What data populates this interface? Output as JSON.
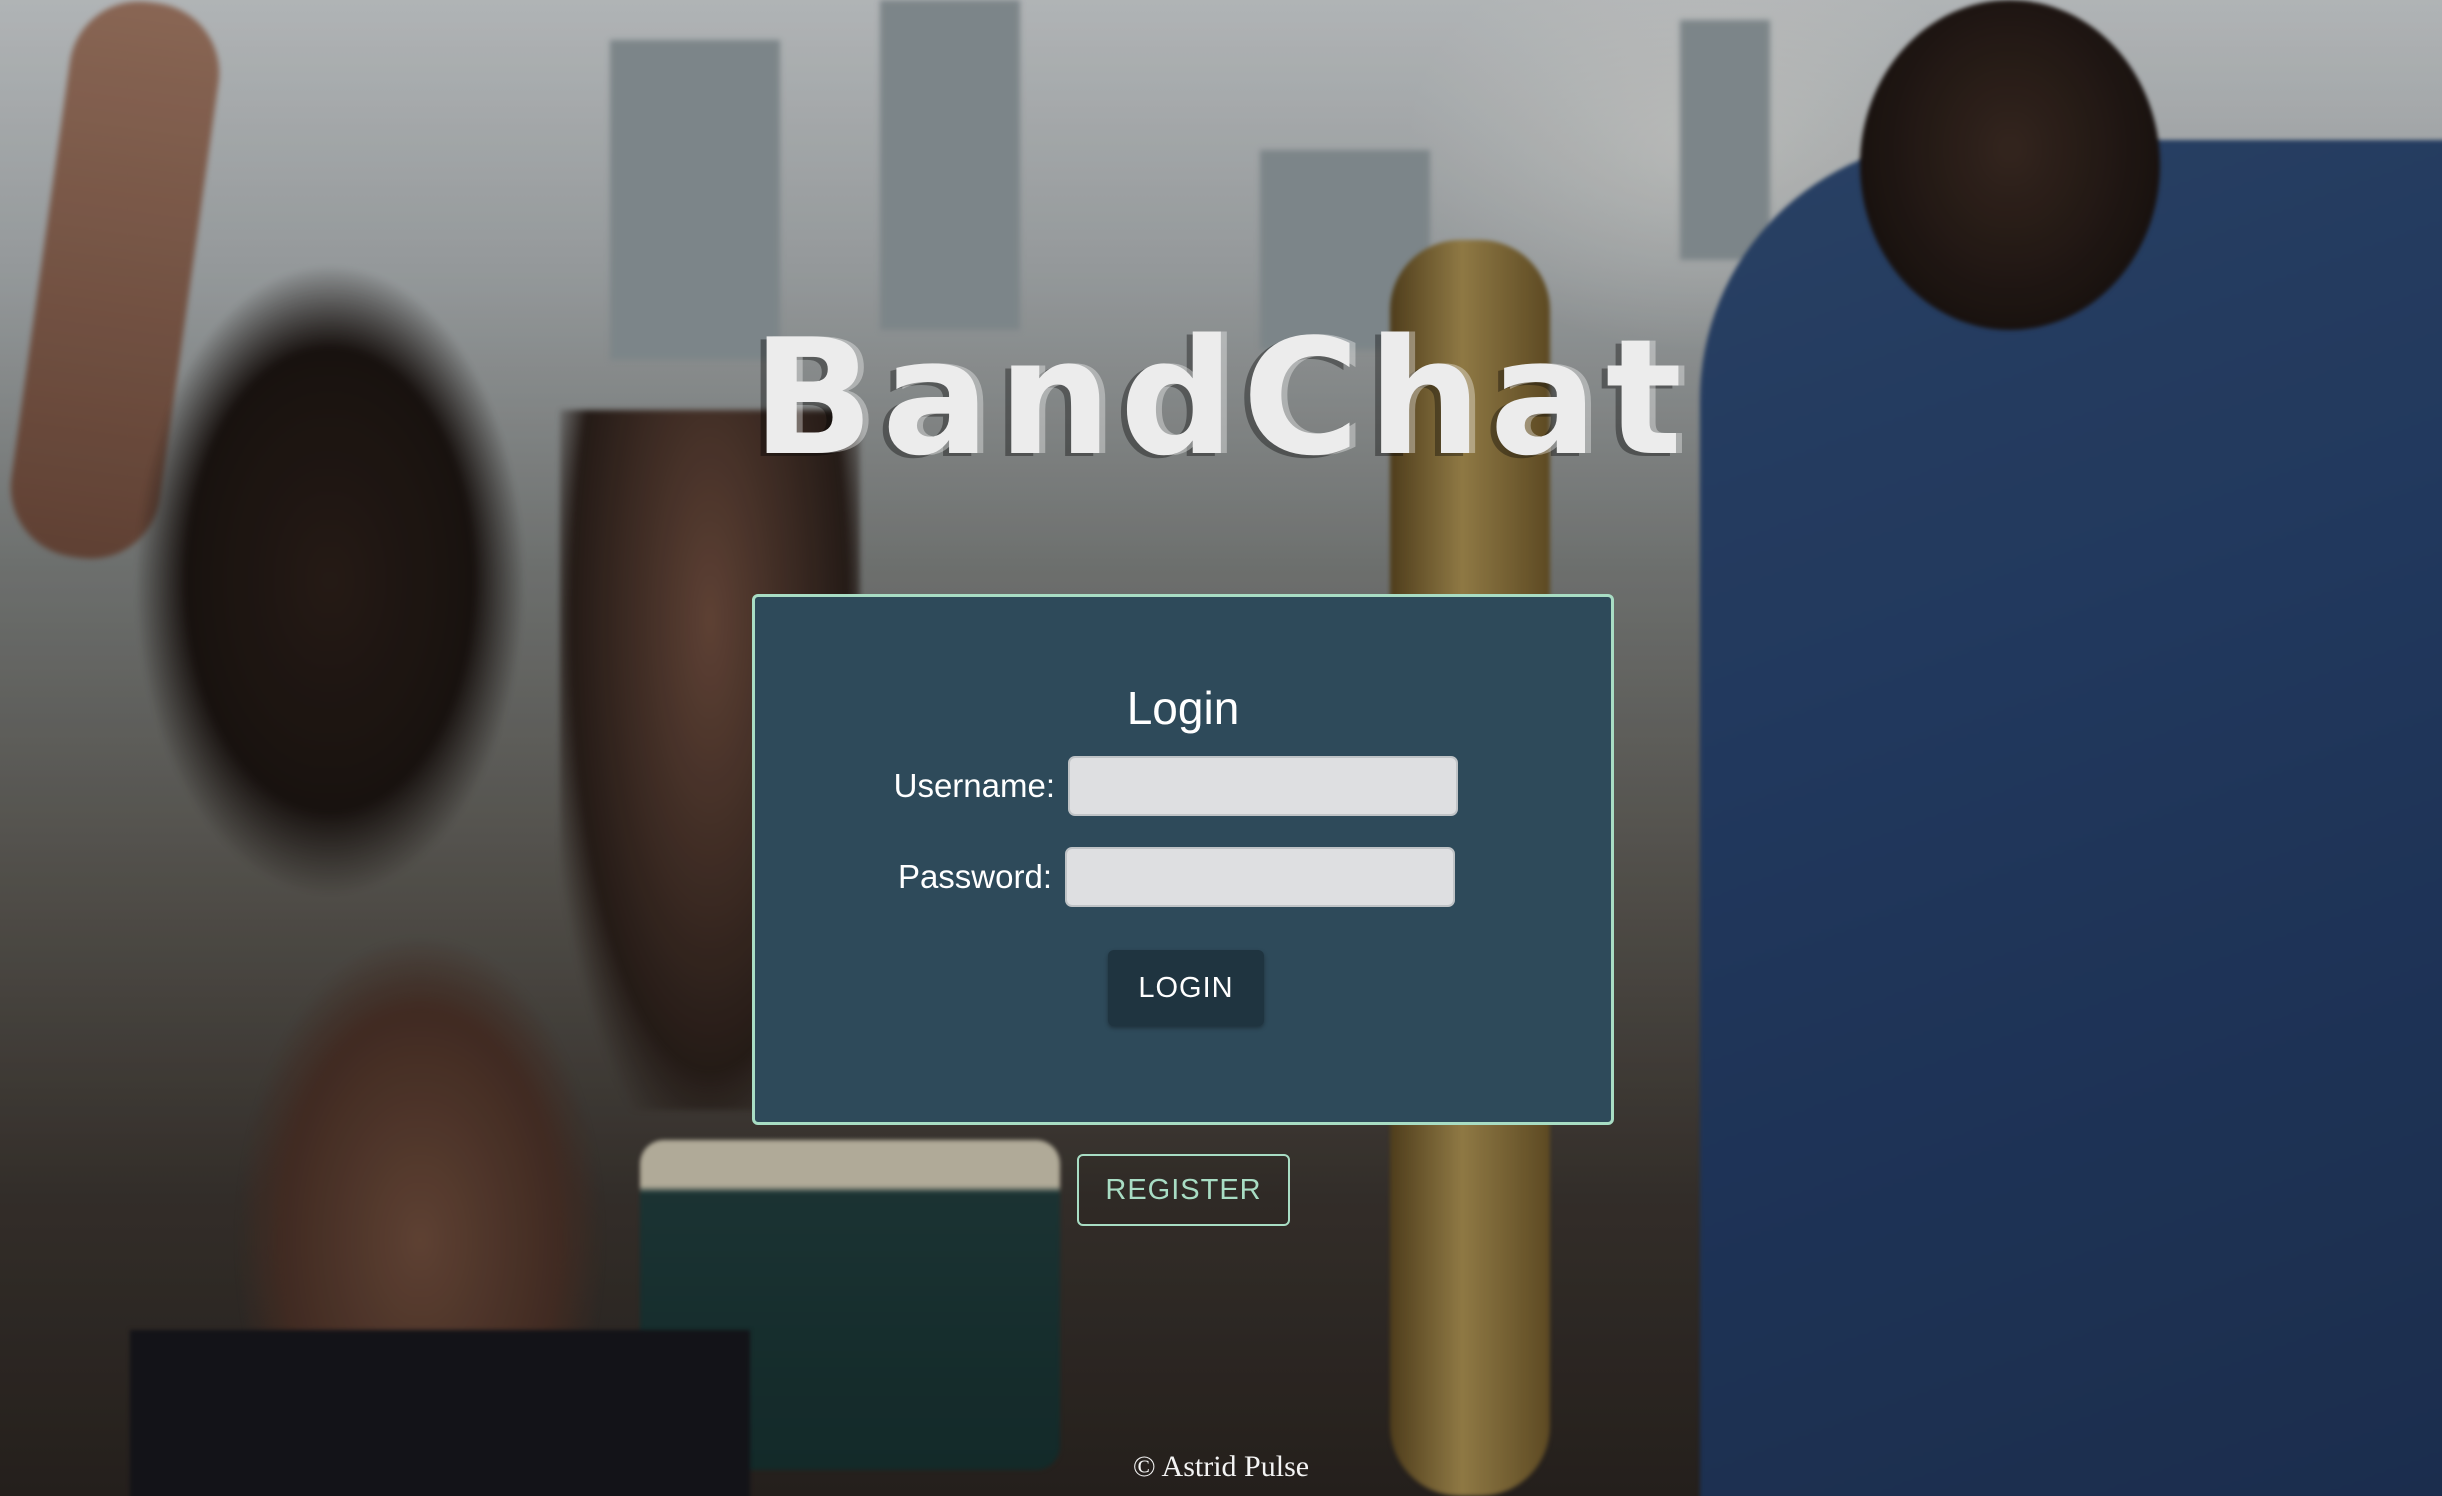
{
  "app": {
    "logo_text": "BandChat"
  },
  "login": {
    "title": "Login",
    "username_label": "Username:",
    "username_value": "",
    "password_label": "Password:",
    "password_value": "",
    "submit_label": "LOGIN"
  },
  "register": {
    "label": "REGISTER"
  },
  "footer": {
    "copyright": "© Astrid Pulse"
  },
  "colors": {
    "card_background": "#2e4a5a",
    "card_border": "#a8ddc4",
    "login_button": "#1f3440",
    "register_accent": "#a8ddc4",
    "input_background": "#dedfe1"
  }
}
